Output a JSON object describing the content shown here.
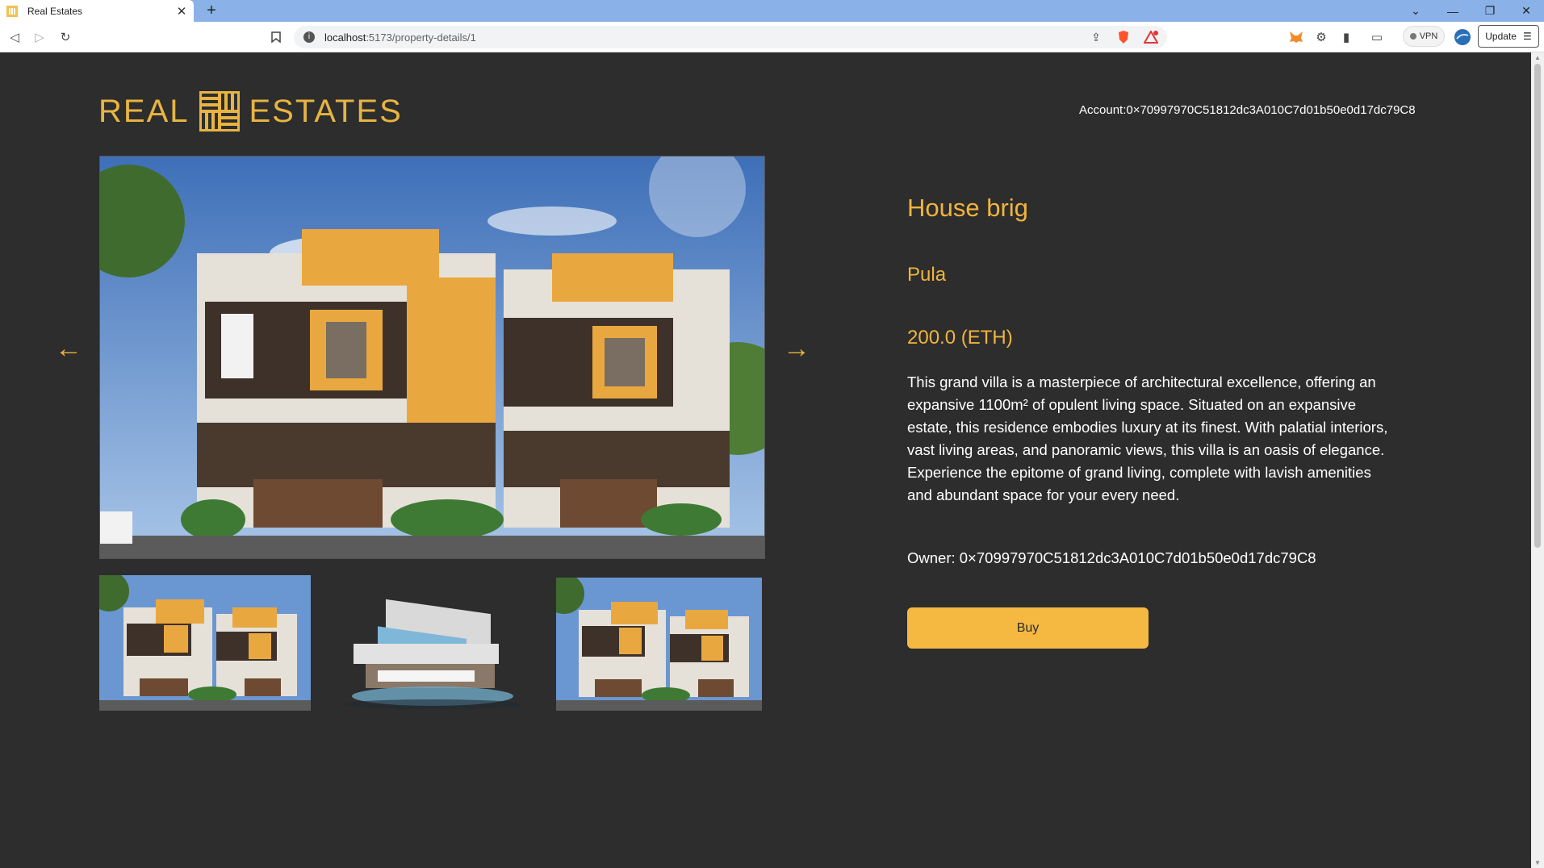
{
  "browser": {
    "tab_title": "Real Estates",
    "tab_close": "✕",
    "new_tab": "+",
    "url_host": "localhost",
    "url_path": ":5173/property-details/1",
    "vpn_label": "VPN",
    "update_label": "Update"
  },
  "header": {
    "logo_left": "REAL",
    "logo_right": "ESTATES",
    "account": "Account:0×70997970C51812dc3A010C7d01b50e0d17dc79C8"
  },
  "gallery": {
    "prev_arrow": "←",
    "next_arrow": "→"
  },
  "property": {
    "name": "House brig",
    "city": "Pula",
    "price": "200.0 (ETH)",
    "description": "This grand villa is a masterpiece of architectural excellence, offering an expansive 1100m² of opulent living space. Situated on an expansive estate, this residence embodies luxury at its finest. With palatial interiors, vast living areas, and panoramic views, this villa is an oasis of elegance. Experience the epitome of grand living, complete with lavish amenities and abundant space for your every need.",
    "owner": "Owner: 0×70997970C51812dc3A010C7d01b50e0d17dc79C8",
    "buy_label": "Buy"
  },
  "colors": {
    "accent": "#f2b43d",
    "background": "#2d2d2d",
    "button": "#f5b942",
    "house_orange": "#e9a83f",
    "house_dark": "#3d3129"
  }
}
